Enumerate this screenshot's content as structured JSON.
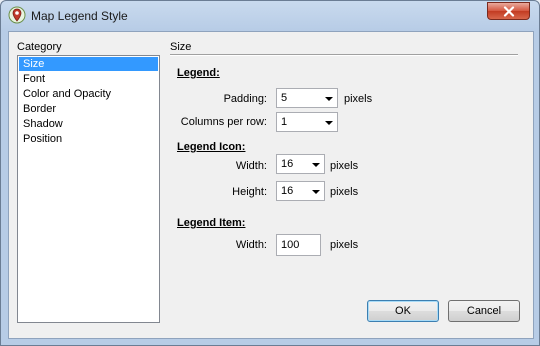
{
  "window": {
    "title": "Map Legend Style"
  },
  "category": {
    "label": "Category",
    "items": [
      {
        "label": "Size",
        "selected": true
      },
      {
        "label": "Font",
        "selected": false
      },
      {
        "label": "Color and Opacity",
        "selected": false
      },
      {
        "label": "Border",
        "selected": false
      },
      {
        "label": "Shadow",
        "selected": false
      },
      {
        "label": "Position",
        "selected": false
      }
    ]
  },
  "panel": {
    "title": "Size",
    "legend": {
      "heading": "Legend:",
      "padding_label": "Padding:",
      "padding_value": "5",
      "padding_unit": "pixels",
      "columns_label": "Columns per row:",
      "columns_value": "1"
    },
    "legend_icon": {
      "heading": "Legend Icon:",
      "width_label": "Width:",
      "width_value": "16",
      "width_unit": "pixels",
      "height_label": "Height:",
      "height_value": "16",
      "height_unit": "pixels"
    },
    "legend_item": {
      "heading": "Legend Item:",
      "width_label": "Width:",
      "width_value": "100",
      "width_unit": "pixels"
    }
  },
  "buttons": {
    "ok": "OK",
    "cancel": "Cancel"
  },
  "colors": {
    "selection": "#3399ff",
    "close_button": "#c23b22"
  }
}
